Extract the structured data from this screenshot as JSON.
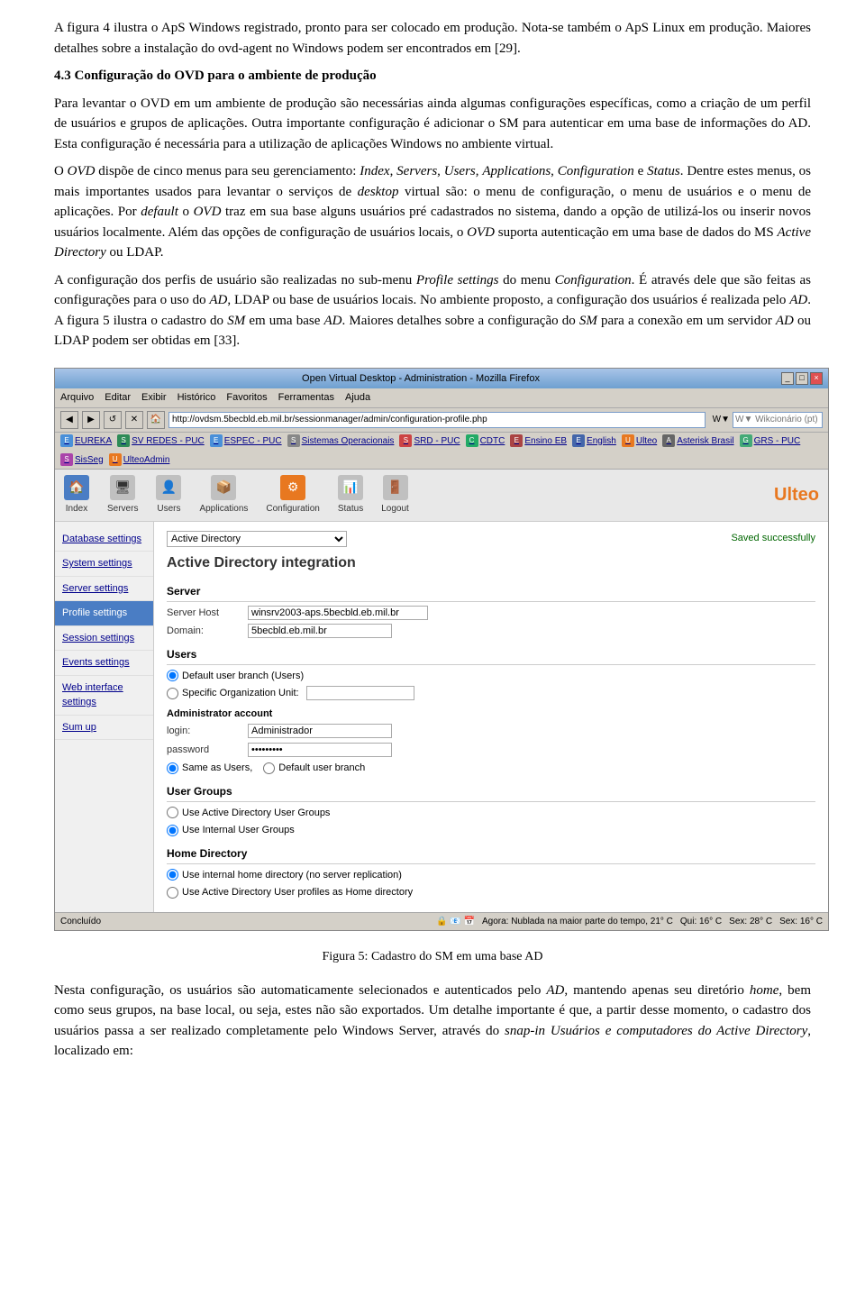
{
  "paragraphs": {
    "p1": "A figura 4 ilustra o ApS Windows registrado, pronto para ser colocado em produção. Nota-se também o ApS Linux em produção. Maiores detalhes sobre a instalação do ovd-agent no Windows podem ser encontrados em [29].",
    "section_heading": "4.3 Configuração do OVD para o ambiente de produção",
    "p2": "Para levantar o OVD em um ambiente de produção são necessárias ainda algumas configurações específicas, como a criação de um perfil de usuários e grupos de aplicações. Outra importante configuração é adicionar o SM para autenticar em uma base de informações do AD. Esta configuração é necessária para a utilização de aplicações Windows no ambiente virtual.",
    "p3": "O OVD dispõe de cinco menus para seu gerenciamento: Index, Servers, Users, Applications, Configuration e Status. Dentre estes menus, os mais importantes usados para levantar o serviços de desktop virtual são: o menu de configuração, o menu de usuários e o menu de aplicações. Por default o OVD traz em sua base alguns usuários pré cadastrados no sistema, dando a opção de utilizá-los ou inserir novos usuários localmente. Além das opções de configuração de usuários locais, o OVD suporta autenticação em uma base de dados do MS Active Directory ou LDAP.",
    "p4": "A configuração dos perfis de usuário são realizadas no sub-menu Profile settings do menu Configuration. É através dele que são feitas as configurações para o uso do AD, LDAP ou base de usuários locais. No ambiente proposto, a configuração dos usuários é realizada pelo AD. A figura 5 ilustra o cadastro do SM em uma base AD. Maiores detalhes sobre a configuração do SM para a conexão em um servidor AD ou LDAP podem ser obtidas em [33]."
  },
  "browser": {
    "title": "Open Virtual Desktop - Administration - Mozilla Firefox",
    "menu_items": [
      "Arquivo",
      "Editar",
      "Exibir",
      "Histórico",
      "Favoritos",
      "Ferramentas",
      "Ajuda"
    ],
    "address": "http://ovdsm.5becbld.eb.mil.br/sessionmanager/admin/configuration-profile.php",
    "search_placeholder": "W▼ Wikcionário (pt)",
    "bookmarks": [
      "E EUREKA",
      "SV REDES - PUC",
      "E ESPEC - PUC",
      "Sistemas Operacionais",
      "SRD - PUC",
      "CDTC",
      "Ensino EB",
      "English",
      "Ulteo",
      "Asterisk Brasil",
      "GRS - PUC",
      "SisSeg",
      "UlteoAdmin"
    ],
    "controls": [
      "_",
      "□",
      "×"
    ]
  },
  "app": {
    "nav_items": [
      "Index",
      "Servers",
      "Users",
      "Applications",
      "Configuration",
      "Status",
      "Logout"
    ],
    "logo": "Ulteo",
    "sidebar_items": [
      "Database settings",
      "System settings",
      "Server settings",
      "Profile settings",
      "Session settings",
      "Events settings",
      "Web interface settings",
      "Sum up"
    ],
    "sidebar_active": "Profile settings",
    "db_dropdown": "Active Directory",
    "saved_msg": "Saved successfully",
    "main_title": "Active Directory integration",
    "server_section": "Server",
    "server_host_label": "Server Host",
    "server_host_value": "winsrv2003-aps.5becbld.eb.mil.br",
    "domain_label": "Domain:",
    "domain_value": "5becbld.eb.mil.br",
    "users_section": "Users",
    "radio_default_branch": "Default user branch (Users)",
    "radio_specific_ou": "Specific Organization Unit:",
    "admin_section": "Administrator account",
    "login_label": "login:",
    "login_value": "Administrador",
    "password_label": "password",
    "password_value": "••••••••",
    "same_as_label": "Same as Users,",
    "default_branch_label": "Default user branch",
    "user_groups_section": "User Groups",
    "radio_ad_groups": "Use Active Directory User Groups",
    "radio_internal_groups": "Use Internal User Groups",
    "home_dir_section": "Home Directory",
    "radio_internal_home": "Use internal home directory (no server replication)",
    "radio_ad_profiles": "Use Active Directory User profiles as Home directory"
  },
  "statusbar": {
    "left": "Concluído",
    "weather": "Agora: Nublada na maior parte do tempo, 21° C",
    "temp1": "Qui: 16° C",
    "temp2": "Sex: 28° C",
    "temp3": "Sex: 16° C"
  },
  "figure_caption": "Figura 5: Cadastro do SM em uma base AD",
  "bottom_paragraphs": {
    "p5": "Nesta configuração, os usuários são automaticamente selecionados e autenticados pelo AD, mantendo apenas seu diretório home, bem como seus grupos, na base local, ou seja, estes não são exportados. Um detalhe importante é que, a partir desse momento, o cadastro dos usuários passa a ser realizado completamente pelo Windows Server, através do snap-in Usuários e computadores do Active Directory, localizado em:"
  }
}
